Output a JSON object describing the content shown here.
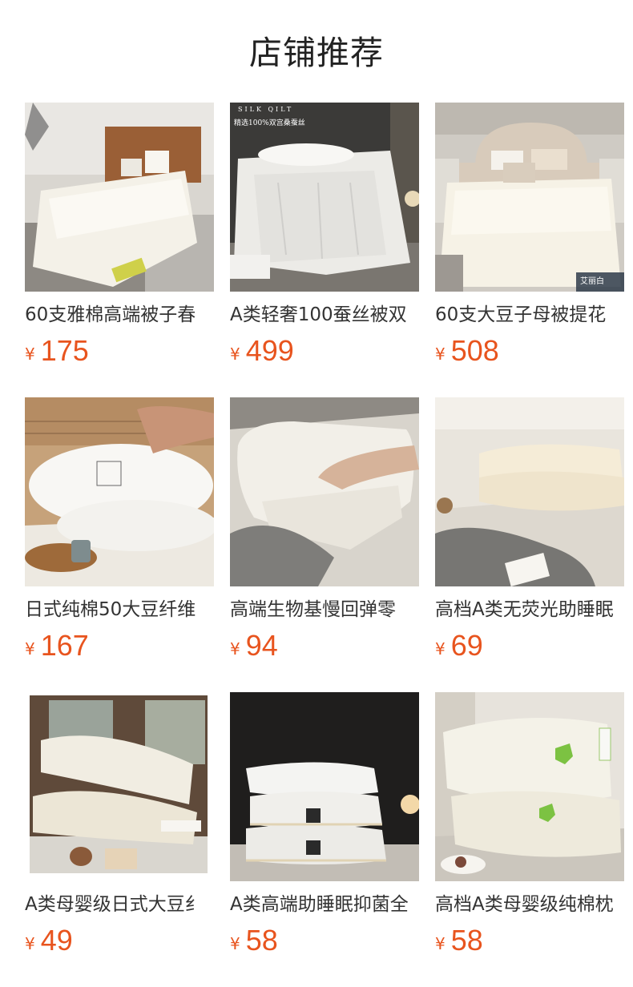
{
  "section": {
    "title": "店铺推荐"
  },
  "colors": {
    "price": "#e8541e",
    "title_text": "#333333",
    "heading_text": "#222222"
  },
  "products": [
    {
      "title": "60支雅棉高端被子春",
      "currency": "¥",
      "price": "175",
      "image": "white-comforter-bedroom",
      "overlay": ""
    },
    {
      "title": "A类轻奢100蚕丝被双",
      "currency": "¥",
      "price": "499",
      "image": "silk-quilt-bed",
      "overlay_top": "SILK QILT",
      "overlay": "精选100%双宫桑蚕丝"
    },
    {
      "title": "60支大豆子母被提花",
      "currency": "¥",
      "price": "508",
      "image": "cream-comforter-tufted-headboard",
      "overlay": "艾丽白"
    },
    {
      "title": "日式纯棉50大豆纤维",
      "currency": "¥",
      "price": "167",
      "image": "soybean-pillow-hand",
      "overlay": ""
    },
    {
      "title": "高端生物基慢回弹零",
      "currency": "¥",
      "price": "94",
      "image": "memory-foam-pillow",
      "overlay": ""
    },
    {
      "title": "高档A类无荧光助睡眠",
      "currency": "¥",
      "price": "69",
      "image": "cream-pillows-stack",
      "overlay": ""
    },
    {
      "title": "A类母婴级日式大豆纟",
      "currency": "¥",
      "price": "49",
      "image": "pillows-window",
      "overlay": ""
    },
    {
      "title": "A类高端助睡眠抑菌全",
      "currency": "¥",
      "price": "58",
      "image": "stacked-pillows-dark",
      "overlay": ""
    },
    {
      "title": "高档A类母婴级纯棉枕",
      "currency": "¥",
      "price": "58",
      "image": "healthy-clean-pillows",
      "overlay": ""
    }
  ]
}
